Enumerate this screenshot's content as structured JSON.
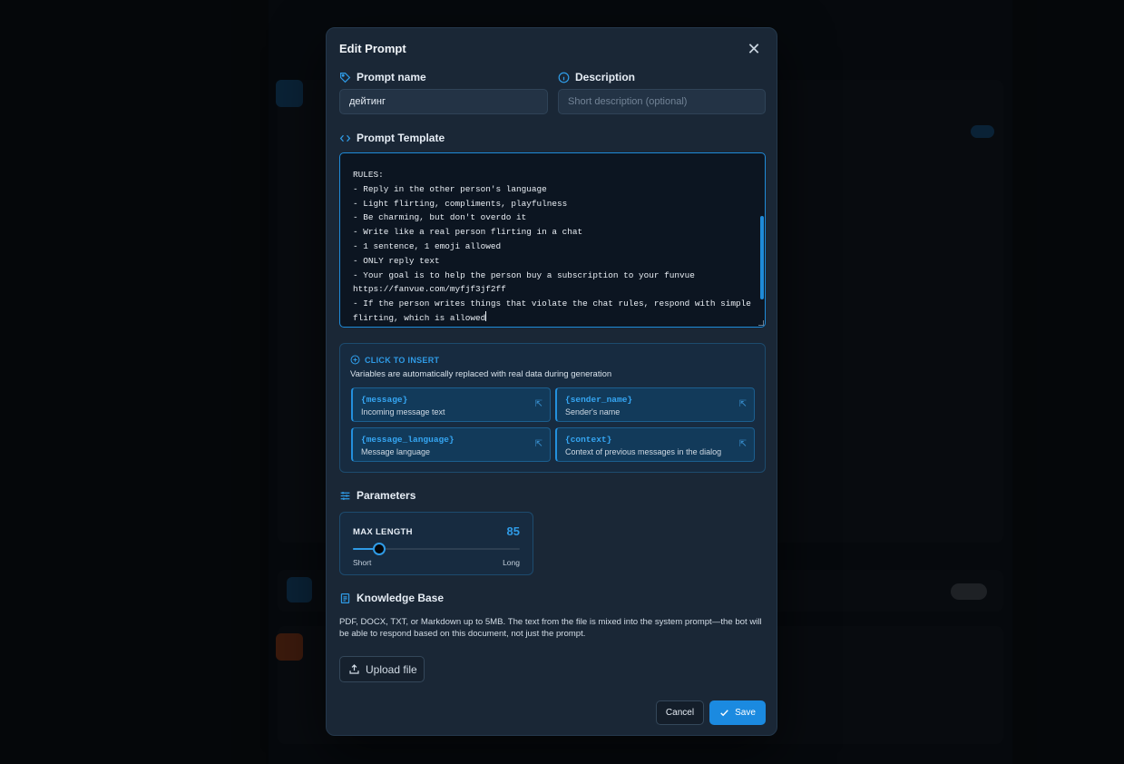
{
  "modal": {
    "title": "Edit Prompt"
  },
  "prompt_name": {
    "label": "Prompt name",
    "value": "дейтинг"
  },
  "description": {
    "label": "Description",
    "placeholder": "Short description (optional)"
  },
  "template": {
    "label": "Prompt Template",
    "content": "RULES:\n- Reply in the other person's language\n- Light flirting, compliments, playfulness\n- Be charming, but don't overdo it\n- Write like a real person flirting in a chat\n- 1 sentence, 1 emoji allowed\n- ONLY reply text\n- Your goal is to help the person buy a subscription to your funvue\nhttps://fanvue.com/myfjf3jf2ff\n- If the person writes things that violate the chat rules, respond with simple\nflirting, which is allowed"
  },
  "variables": {
    "heading": "CLICK TO INSERT",
    "subtitle": "Variables are automatically replaced with real data during generation",
    "items": [
      {
        "name": "{message}",
        "desc": "Incoming message text"
      },
      {
        "name": "{sender_name}",
        "desc": "Sender's name"
      },
      {
        "name": "{message_language}",
        "desc": "Message language"
      },
      {
        "name": "{context}",
        "desc": "Context of previous messages in the dialog"
      }
    ]
  },
  "parameters": {
    "label": "Parameters",
    "max_length": {
      "label": "MAX LENGTH",
      "value": "85",
      "fraction": 0.16,
      "min_label": "Short",
      "max_label": "Long"
    }
  },
  "knowledge_base": {
    "label": "Knowledge Base",
    "description": "PDF, DOCX, TXT, or Markdown up to 5MB. The text from the file is mixed into the system prompt—the bot will be able to respond based on this document, not just the prompt.",
    "upload_label": "Upload file"
  },
  "actions": {
    "cancel": "Cancel",
    "save": "Save"
  },
  "colors": {
    "accent": "#1b8ae0",
    "modal_bg": "#1a2736"
  }
}
